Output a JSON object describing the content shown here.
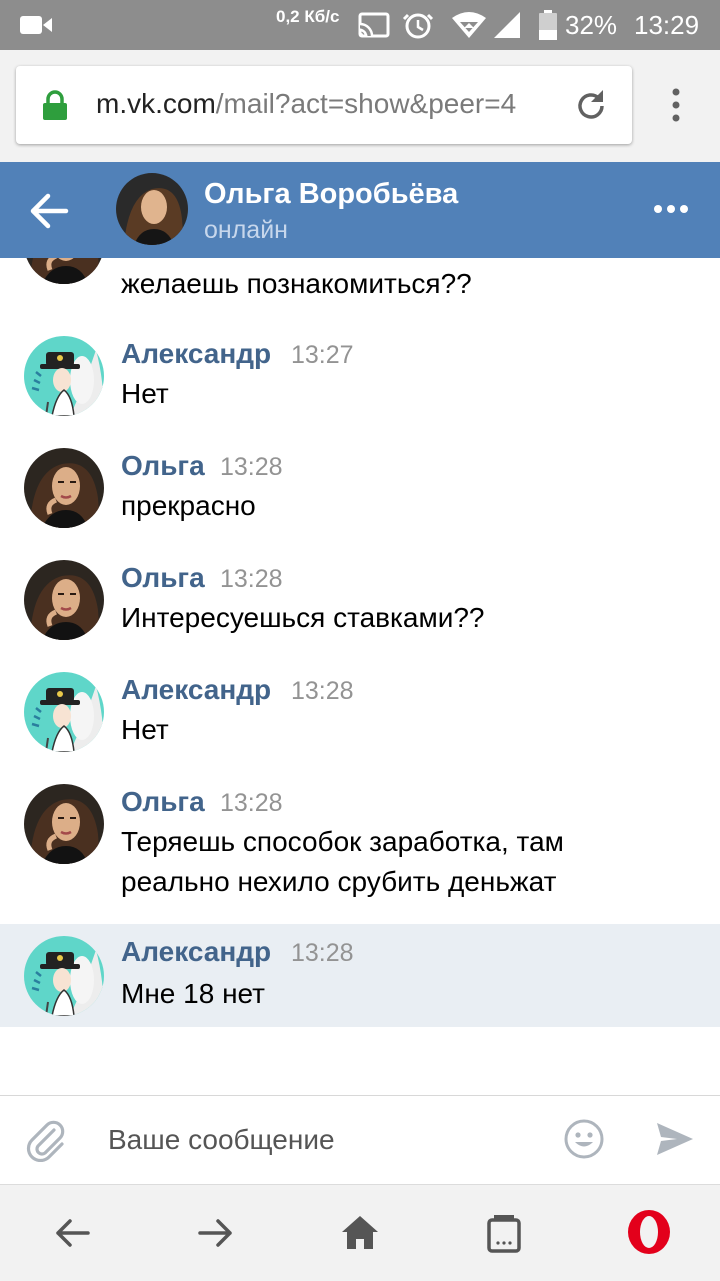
{
  "status_bar": {
    "net_speed": "0,2 Кб/с",
    "battery": "32%",
    "time": "13:29",
    "icons": [
      "video-camera-icon",
      "cast-icon",
      "alarm-icon",
      "wifi-icon",
      "signal-icon",
      "battery-icon"
    ]
  },
  "browser": {
    "url_host": "m.vk.com",
    "url_path": "/mail?act=show&peer=4",
    "secure": true
  },
  "chat": {
    "name": "Ольга Воробьёва",
    "status": "онлайн"
  },
  "messages": [
    {
      "author": "",
      "time": "",
      "text": "желаешь познакомиться??",
      "sender": "olga"
    },
    {
      "author": "Александр",
      "time": "13:27",
      "text": "Нет",
      "sender": "alex"
    },
    {
      "author": "Ольга",
      "time": "13:28",
      "text": "прекрасно",
      "sender": "olga"
    },
    {
      "author": "Ольга",
      "time": "13:28",
      "text": "Интересуешься ставками??",
      "sender": "olga"
    },
    {
      "author": "Александр",
      "time": "13:28",
      "text": "Нет",
      "sender": "alex"
    },
    {
      "author": "Ольга",
      "time": "13:28",
      "text": "Теряешь способок заработка, там реально нехило срубить деньжат",
      "sender": "olga"
    },
    {
      "author": "Александр",
      "time": "13:28",
      "text": "Мне 18 нет",
      "sender": "alex",
      "highlighted": true
    }
  ],
  "composer": {
    "placeholder": "Ваше сообщение"
  },
  "colors": {
    "vk_header": "#5181b8",
    "author_name": "#42648b",
    "highlight_row": "#e9eef3",
    "lock_green": "#2e9e3d",
    "opera_red": "#e3001b"
  }
}
